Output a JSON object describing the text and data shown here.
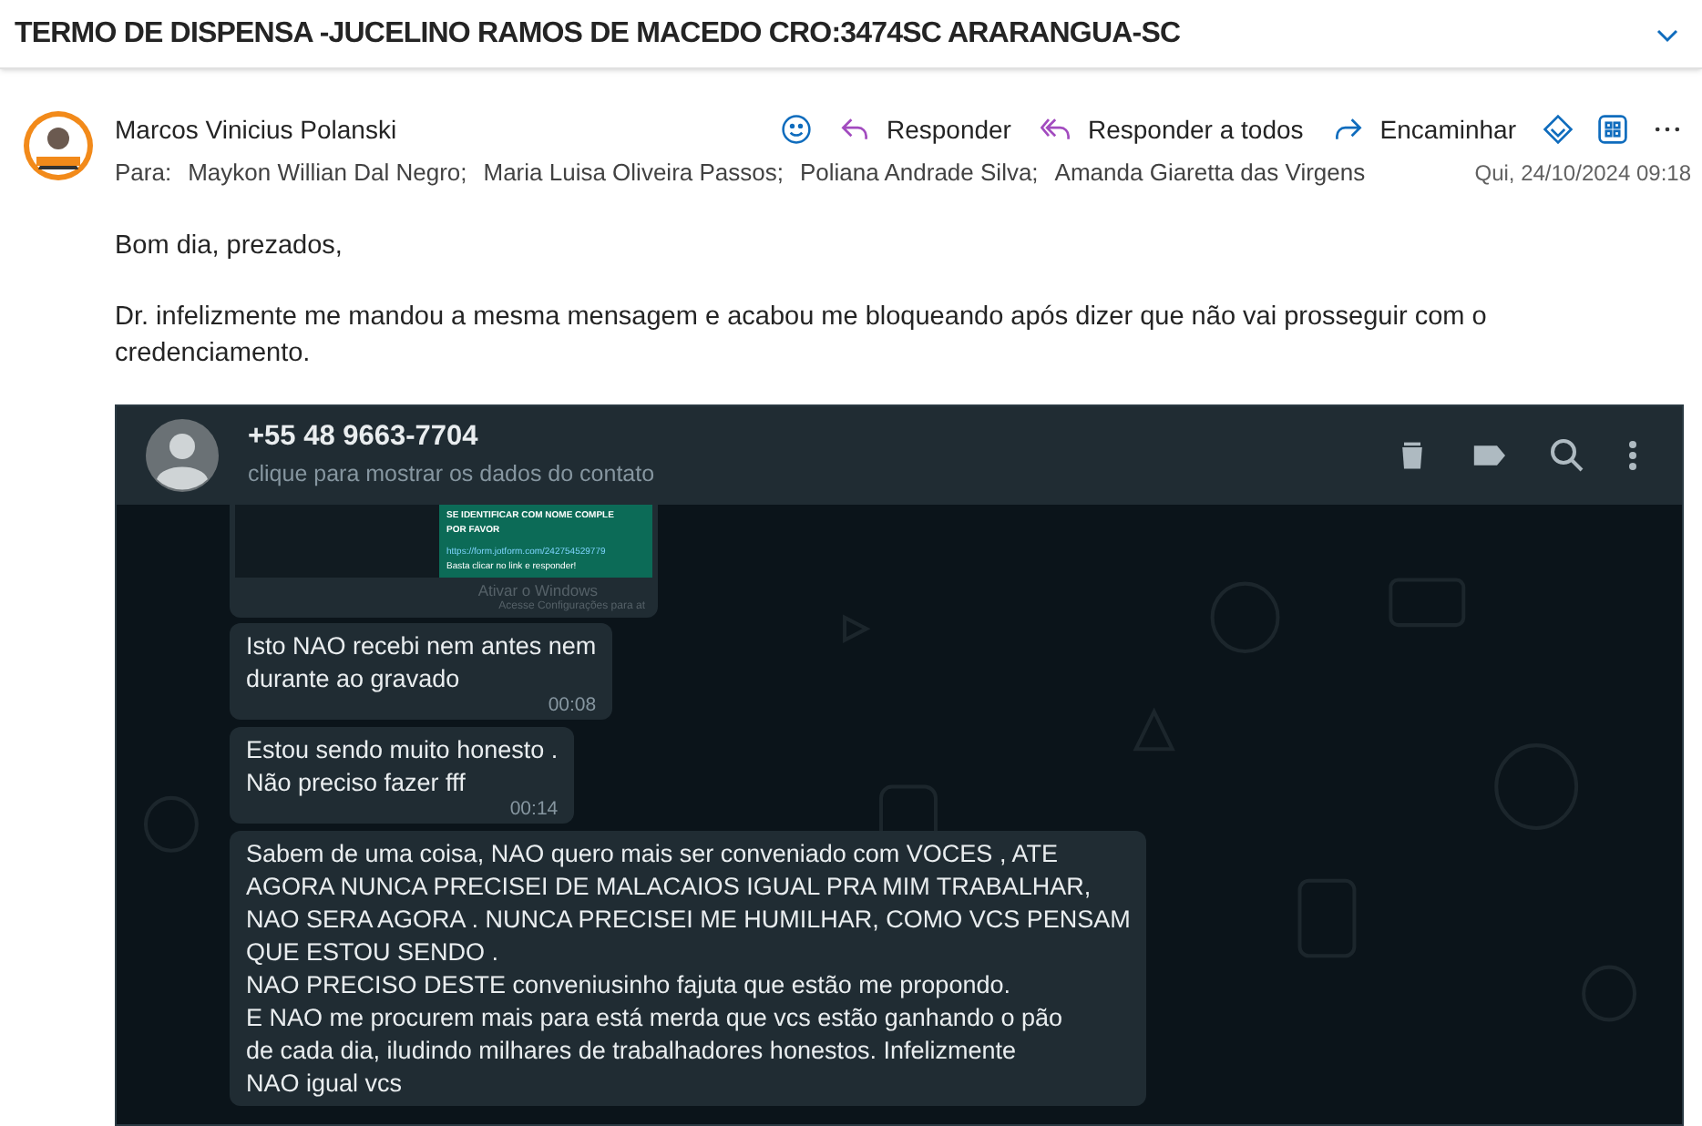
{
  "subject": "TERMO DE DISPENSA -JUCELINO RAMOS DE MACEDO CRO:3474SC ARARANGUA-SC",
  "message": {
    "sender": "Marcos Vinicius Polanski",
    "to_label": "Para:",
    "recipients": [
      "Maykon Willian Dal Negro;",
      "Maria Luisa Oliveira Passos;",
      "Poliana Andrade Silva;",
      "Amanda Giaretta das Virgens"
    ],
    "date": "Qui, 24/10/2024 09:18",
    "actions": [
      {
        "kind": "react"
      },
      {
        "kind": "reply",
        "label": "Responder"
      },
      {
        "kind": "reply_all",
        "label": "Responder a todos"
      },
      {
        "kind": "forward",
        "label": "Encaminhar"
      },
      {
        "kind": "loop"
      },
      {
        "kind": "apps"
      },
      {
        "kind": "more"
      }
    ],
    "body": [
      "Bom dia,  prezados,",
      "Dr. infelizmente me mandou a mesma mensagem e acabou me bloqueando após dizer que não vai prosseguir com o credenciamento."
    ]
  },
  "chat": {
    "contact": "+55 48 9663-7704",
    "subtitle": "clique para mostrar os dados do contato",
    "card": {
      "lines": [
        "SE IDENTIFICAR COM NOME COMPLE",
        "POR FAVOR"
      ],
      "link": "https://form.jotform.com/242754529779",
      "note": "Basta clicar no link e responder!"
    },
    "watermark": [
      "Ativar o Windows",
      "Acesse Configurações para at"
    ],
    "messages": [
      {
        "text": "Isto NAO recebi nem antes nem\ndurante ao gravado",
        "time": "00:08"
      },
      {
        "text": "Estou sendo muito honesto .\nNão preciso fazer fff",
        "time": "00:14"
      },
      {
        "text": "Sabem de uma coisa, NAO quero mais ser conveniado com VOCES ,  ATE\nAGORA NUNCA PRECISEI DE MALACAIOS IGUAL PRA MIM TRABALHAR,\nNAO SERA AGORA . NUNCA PRECISEI ME HUMILHAR, COMO VCS PENSAM\nQUE ESTOU SENDO .\nNAO PRECISO DESTE conveniusinho fajuta que estão me propondo.\nE NAO  me procurem mais para está merda que vcs estão ganhando o pão\nde cada dia, iludindo milhares de trabalhadores honestos. Infelizmente\nNAO igual vcs"
      }
    ]
  }
}
